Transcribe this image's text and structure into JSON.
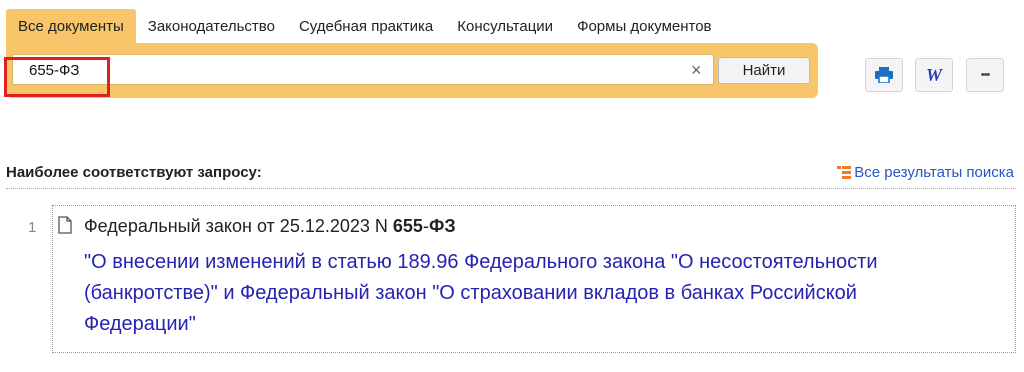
{
  "tabs": [
    {
      "label": "Все документы",
      "active": true
    },
    {
      "label": "Законодательство"
    },
    {
      "label": "Судебная практика"
    },
    {
      "label": "Консультации"
    },
    {
      "label": "Формы документов"
    }
  ],
  "search": {
    "value": "655-ФЗ",
    "clear_glyph": "×",
    "button_label": "Найти"
  },
  "toolbar": {
    "more_glyph": "•••",
    "word_glyph": "W"
  },
  "results": {
    "section_title": "Наиболее соответствуют запросу:",
    "all_results_label": "Все результаты поиска",
    "items": [
      {
        "number": "1",
        "header_prefix": "Федеральный закон от 25.12.2023 N ",
        "header_num_bold": "655",
        "header_dash": "-",
        "header_suffix_bold": "ФЗ",
        "title": "\"О внесении изменений в статью 189.96 Федерального закона \"О несостоятельности (банкротстве)\" и Федеральный закон \"О страховании вкладов в банках Российской Федерации\""
      }
    ]
  },
  "colors": {
    "accent": "#f8c56a",
    "link": "#2424b0",
    "highlight": "#e02020"
  }
}
